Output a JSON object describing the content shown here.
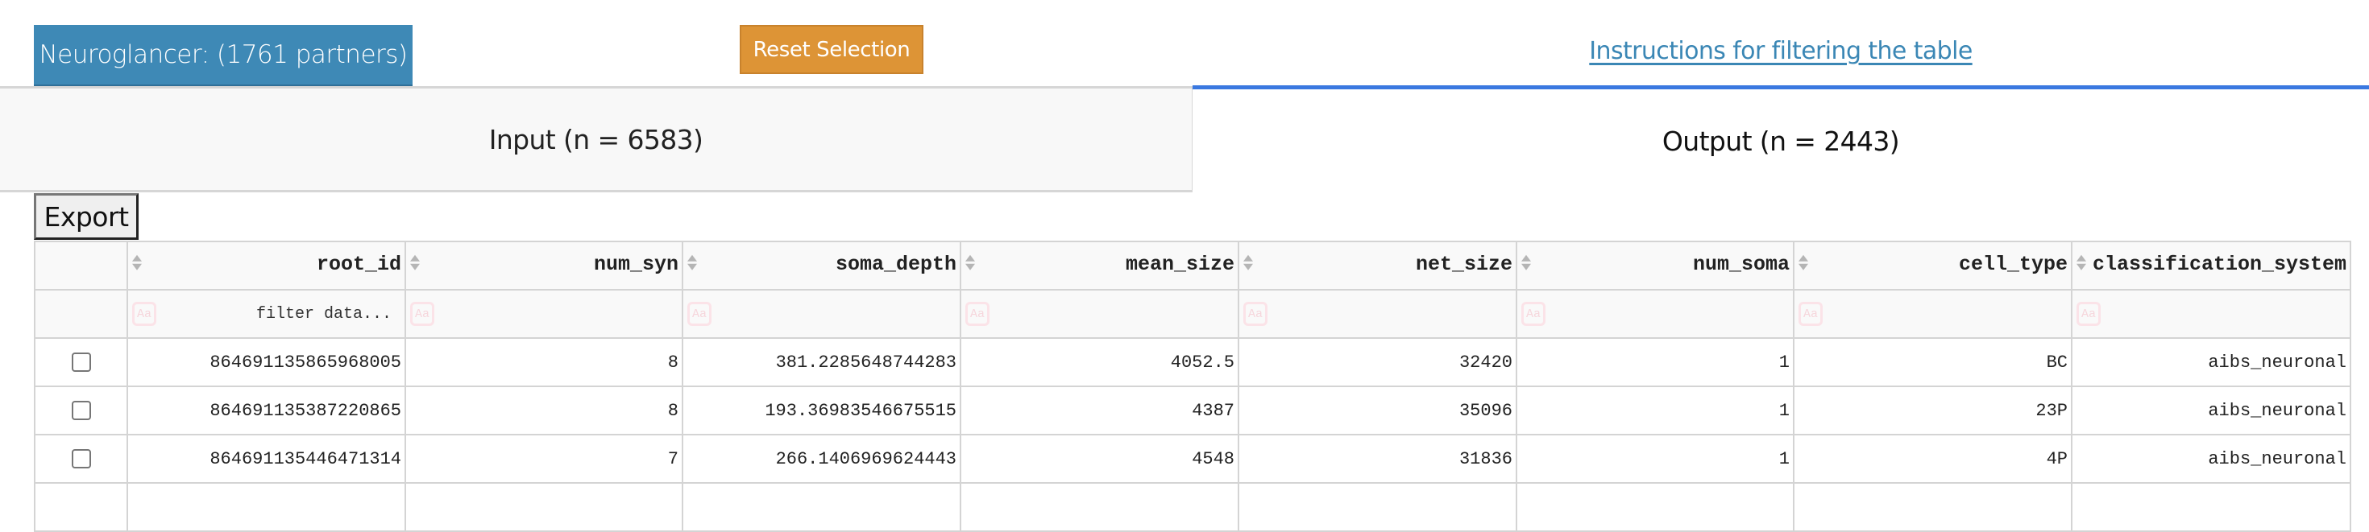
{
  "header": {
    "neuroglancer_button": "Neuroglancer: (1761 partners)",
    "reset_button": "Reset Selection",
    "instructions_link": "Instructions for filtering the table"
  },
  "tabs": [
    {
      "label": "Input (n = 6583)",
      "active": false
    },
    {
      "label": "Output (n = 2443)",
      "active": true
    }
  ],
  "toolbar": {
    "export_label": "Export"
  },
  "table": {
    "columns": [
      "root_id",
      "num_syn",
      "soma_depth",
      "mean_size",
      "net_size",
      "num_soma",
      "cell_type",
      "classification_system"
    ],
    "filter_placeholder": "filter data...",
    "filter_icon_label": "Aa",
    "rows": [
      {
        "checked": false,
        "cells": [
          "864691135865968005",
          "8",
          "381.2285648744283",
          "4052.5",
          "32420",
          "1",
          "BC",
          "aibs_neuronal"
        ]
      },
      {
        "checked": false,
        "cells": [
          "864691135387220865",
          "8",
          "193.36983546675515",
          "4387",
          "35096",
          "1",
          "23P",
          "aibs_neuronal"
        ]
      },
      {
        "checked": false,
        "cells": [
          "864691135446471314",
          "7",
          "266.1406969624443",
          "4548",
          "31836",
          "1",
          "4P",
          "aibs_neuronal"
        ]
      },
      {
        "checked": false,
        "cells": [
          "",
          "",
          "",
          "",
          "",
          "",
          "",
          ""
        ]
      }
    ]
  },
  "colors": {
    "neuroglancer_button": "#3e89b6",
    "reset_button": "#dd9436",
    "link": "#3b87b5",
    "active_tab_indicator": "#3a78e0"
  }
}
